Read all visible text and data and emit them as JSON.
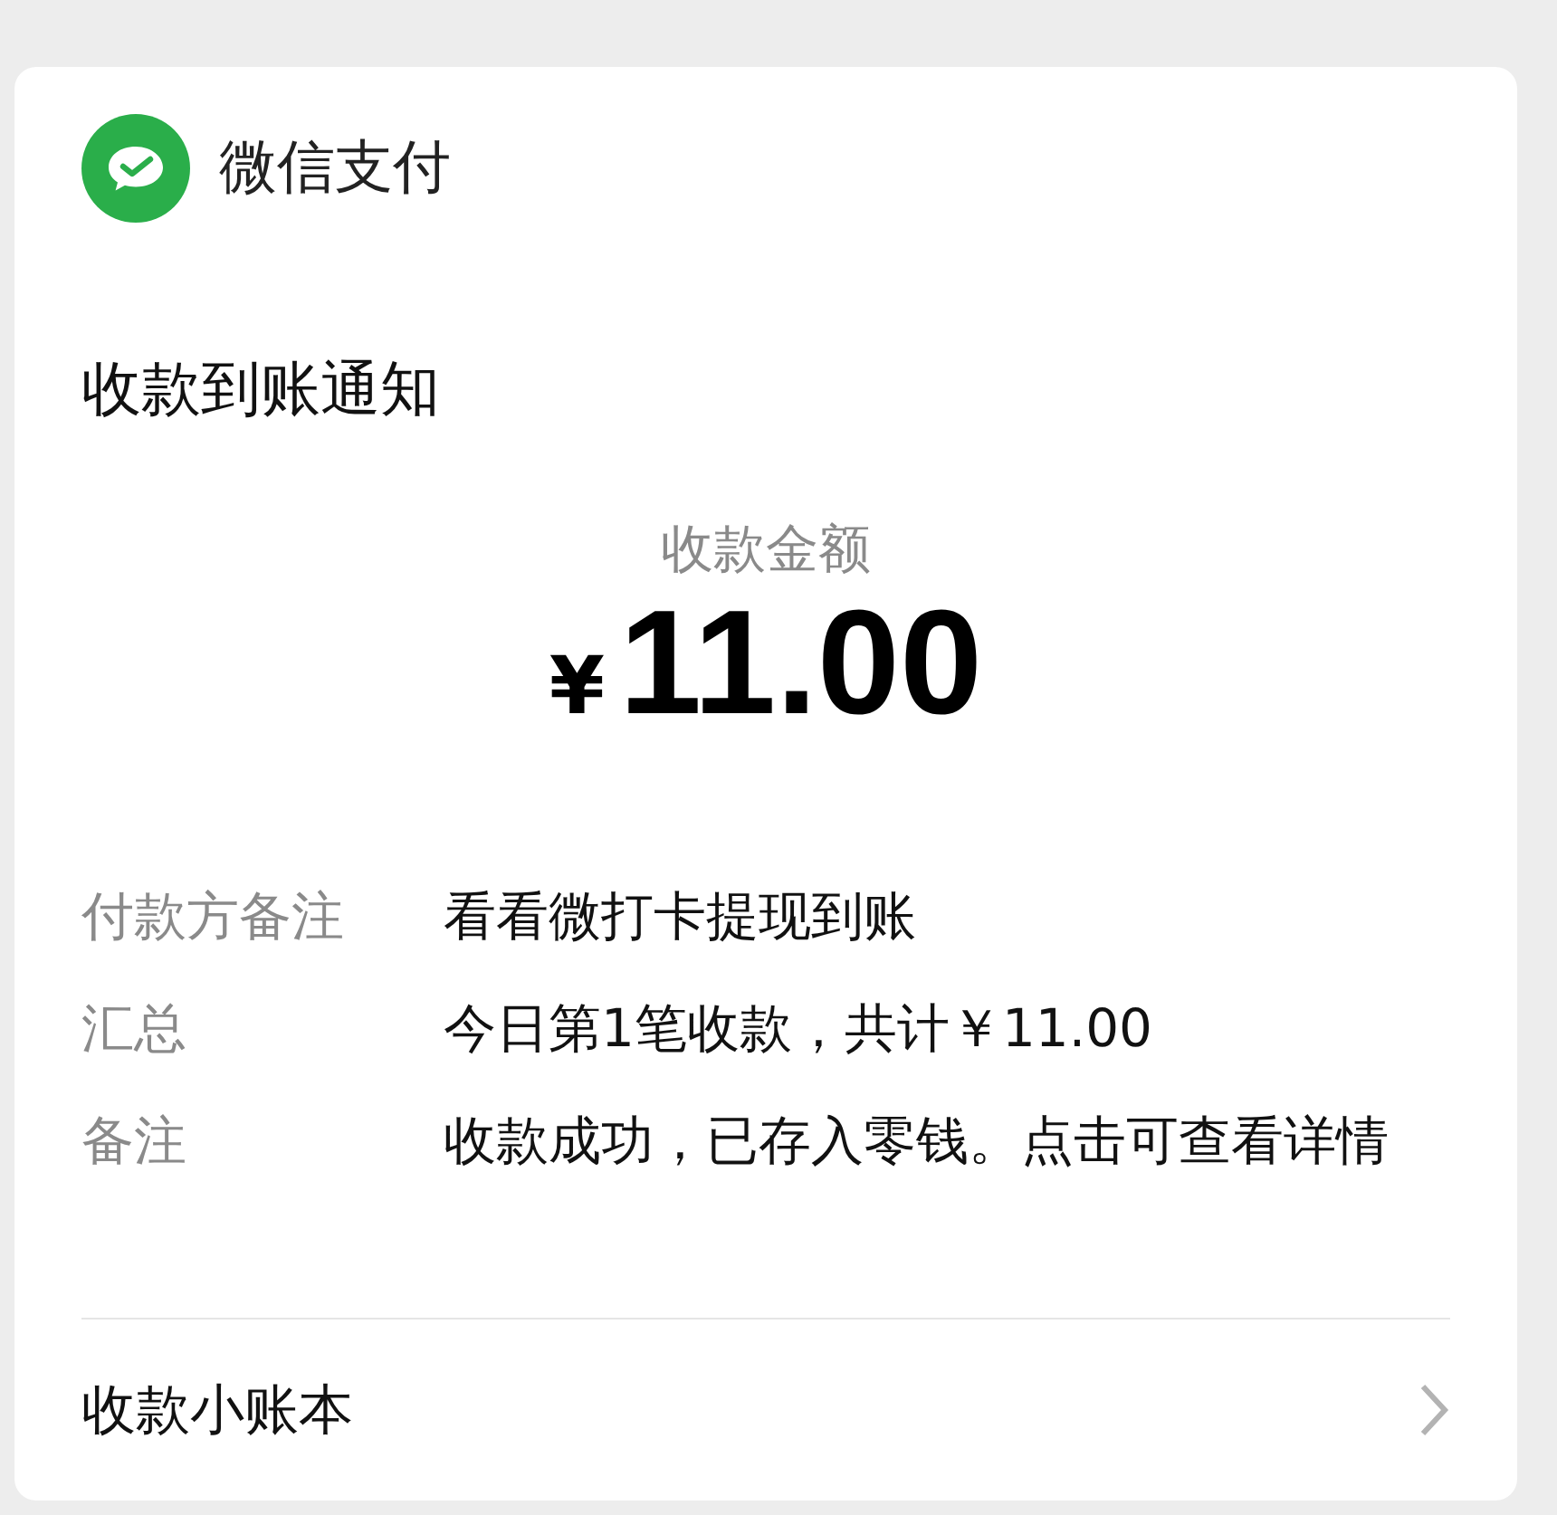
{
  "app": {
    "name": "微信支付"
  },
  "title": "收款到账通知",
  "amount": {
    "label": "收款金额",
    "currency": "¥",
    "value": "11.00"
  },
  "details": [
    {
      "label": "付款方备注",
      "value": "看看微打卡提现到账"
    },
    {
      "label": "汇总",
      "value": "今日第1笔收款，共计￥11.00"
    },
    {
      "label": "备注",
      "value": "收款成功，已存入零钱。点击可查看详情"
    }
  ],
  "footer": {
    "label": "收款小账本"
  }
}
